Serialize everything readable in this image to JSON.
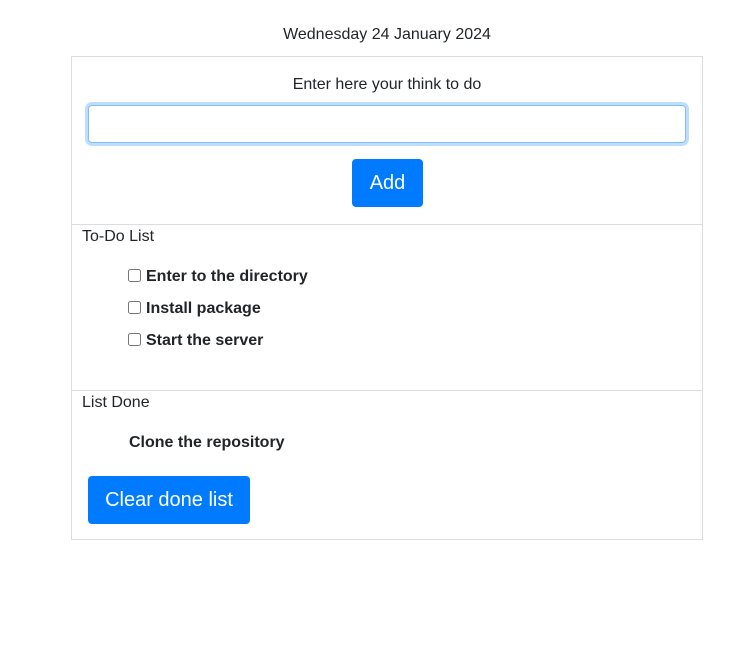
{
  "header": {
    "date": "Wednesday 24 January 2024"
  },
  "add_section": {
    "prompt": "Enter here your think to do",
    "input_value": "",
    "add_label": "Add"
  },
  "todo_section": {
    "title": "To-Do List",
    "items": [
      {
        "label": "Enter to the directory",
        "checked": false
      },
      {
        "label": "Install package",
        "checked": false
      },
      {
        "label": "Start the server",
        "checked": false
      }
    ]
  },
  "done_section": {
    "title": "List Done",
    "items": [
      {
        "label": "Clone the repository"
      }
    ],
    "clear_label": "Clear done list"
  },
  "colors": {
    "accent": "#007bff",
    "border": "#dcdcdc",
    "text": "#212529"
  }
}
